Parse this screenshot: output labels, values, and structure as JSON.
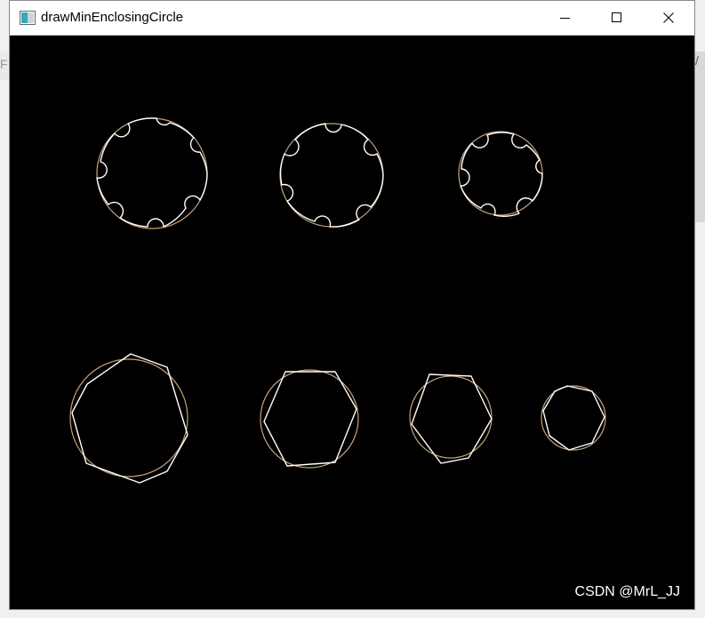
{
  "window": {
    "title": "drawMinEnclosingCircle"
  },
  "watermark": "CSDN @MrL_JJ",
  "colors": {
    "contour": "#ffffff",
    "enclosing_circle": "#c8a27a",
    "canvas": "#000000"
  },
  "icons": {
    "app": "app-window-icon",
    "minimize": "minimize-icon",
    "maximize": "maximize-icon",
    "close": "close-icon"
  }
}
